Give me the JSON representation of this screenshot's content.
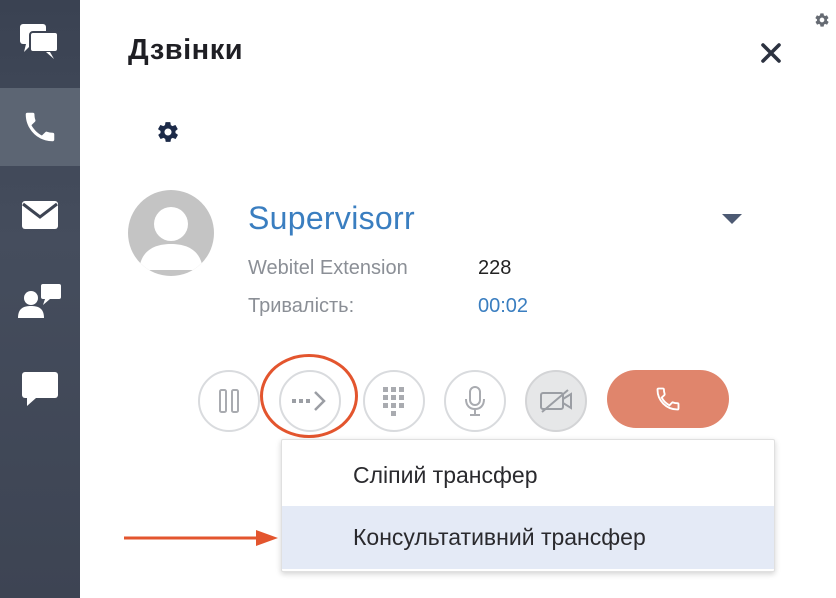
{
  "sidebar": {
    "items": [
      {
        "icon": "conversations-icon",
        "active": false
      },
      {
        "icon": "phone-icon",
        "active": true
      },
      {
        "icon": "mail-icon",
        "active": false
      },
      {
        "icon": "contacts-icon",
        "active": false
      },
      {
        "icon": "chat-icon",
        "active": false
      }
    ]
  },
  "header": {
    "title": "Дзвінки"
  },
  "call": {
    "name": "Supervisorr",
    "extension_label": "Webitel Extension",
    "extension_value": "228",
    "duration_label": "Тривалість:",
    "duration_value": "00:02"
  },
  "controls": [
    "hold",
    "transfer",
    "keypad",
    "mute",
    "video",
    "hangup"
  ],
  "transfer_menu": {
    "items": [
      {
        "label": "Сліпий трансфер"
      },
      {
        "label": "Консультативний трансфер"
      }
    ],
    "highlighted_index": 1
  },
  "colors": {
    "accent": "#3a7ec0",
    "hangup": "#e0856c",
    "annotation": "#e3552e",
    "sidebar": "#3f4656",
    "menu_highlight": "#e4eaf6"
  }
}
